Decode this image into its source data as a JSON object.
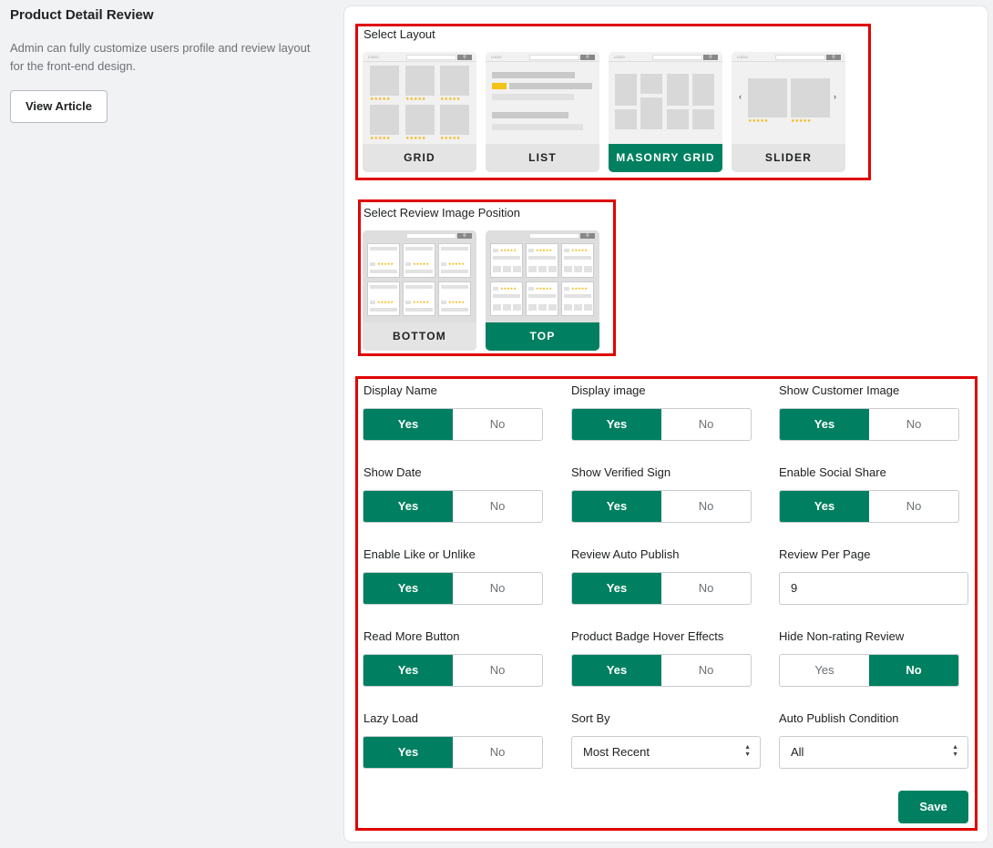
{
  "page": {
    "title": "Product Detail Review",
    "description": "Admin can fully customize users profile and review layout for the front-end design.",
    "view_article": "View Article"
  },
  "layout": {
    "label": "Select Layout",
    "options": [
      {
        "label": "GRID",
        "selected": false
      },
      {
        "label": "LIST",
        "selected": false
      },
      {
        "label": "MASONRY GRID",
        "selected": true
      },
      {
        "label": "SLIDER",
        "selected": false
      }
    ],
    "preview_logo": "LOGO"
  },
  "image_position": {
    "label": "Select Review Image Position",
    "options": [
      {
        "label": "BOTTOM",
        "selected": false
      },
      {
        "label": "TOP",
        "selected": true
      }
    ]
  },
  "settings": {
    "display_name": {
      "label": "Display Name",
      "yes": "Yes",
      "no": "No",
      "value": "Yes"
    },
    "display_image": {
      "label": "Display image",
      "yes": "Yes",
      "no": "No",
      "value": "Yes"
    },
    "show_customer_image": {
      "label": "Show Customer Image",
      "yes": "Yes",
      "no": "No",
      "value": "Yes"
    },
    "show_date": {
      "label": "Show Date",
      "yes": "Yes",
      "no": "No",
      "value": "Yes"
    },
    "show_verified_sign": {
      "label": "Show Verified Sign",
      "yes": "Yes",
      "no": "No",
      "value": "Yes"
    },
    "enable_social_share": {
      "label": "Enable Social Share",
      "yes": "Yes",
      "no": "No",
      "value": "Yes"
    },
    "enable_like": {
      "label": "Enable Like or Unlike",
      "yes": "Yes",
      "no": "No",
      "value": "Yes"
    },
    "review_auto_publish": {
      "label": "Review Auto Publish",
      "yes": "Yes",
      "no": "No",
      "value": "Yes"
    },
    "review_per_page": {
      "label": "Review Per Page",
      "value": "9"
    },
    "read_more_button": {
      "label": "Read More Button",
      "yes": "Yes",
      "no": "No",
      "value": "Yes"
    },
    "badge_hover": {
      "label": "Product Badge Hover Effects",
      "yes": "Yes",
      "no": "No",
      "value": "Yes"
    },
    "hide_non_rating": {
      "label": "Hide Non-rating Review",
      "yes": "Yes",
      "no": "No",
      "value": "No"
    },
    "lazy_load": {
      "label": "Lazy Load",
      "yes": "Yes",
      "no": "No",
      "value": "Yes"
    },
    "sort_by": {
      "label": "Sort By",
      "value": "Most Recent"
    },
    "auto_publish_condition": {
      "label": "Auto Publish Condition",
      "value": "All"
    }
  },
  "save_label": "Save",
  "colors": {
    "accent": "#008060",
    "highlight": "#e00000",
    "stars": "#f2b300"
  },
  "icons": {
    "search": "search-icon",
    "chevron_left": "chevron-left-icon",
    "chevron_right": "chevron-right-icon",
    "caret": "select-caret-icon"
  }
}
